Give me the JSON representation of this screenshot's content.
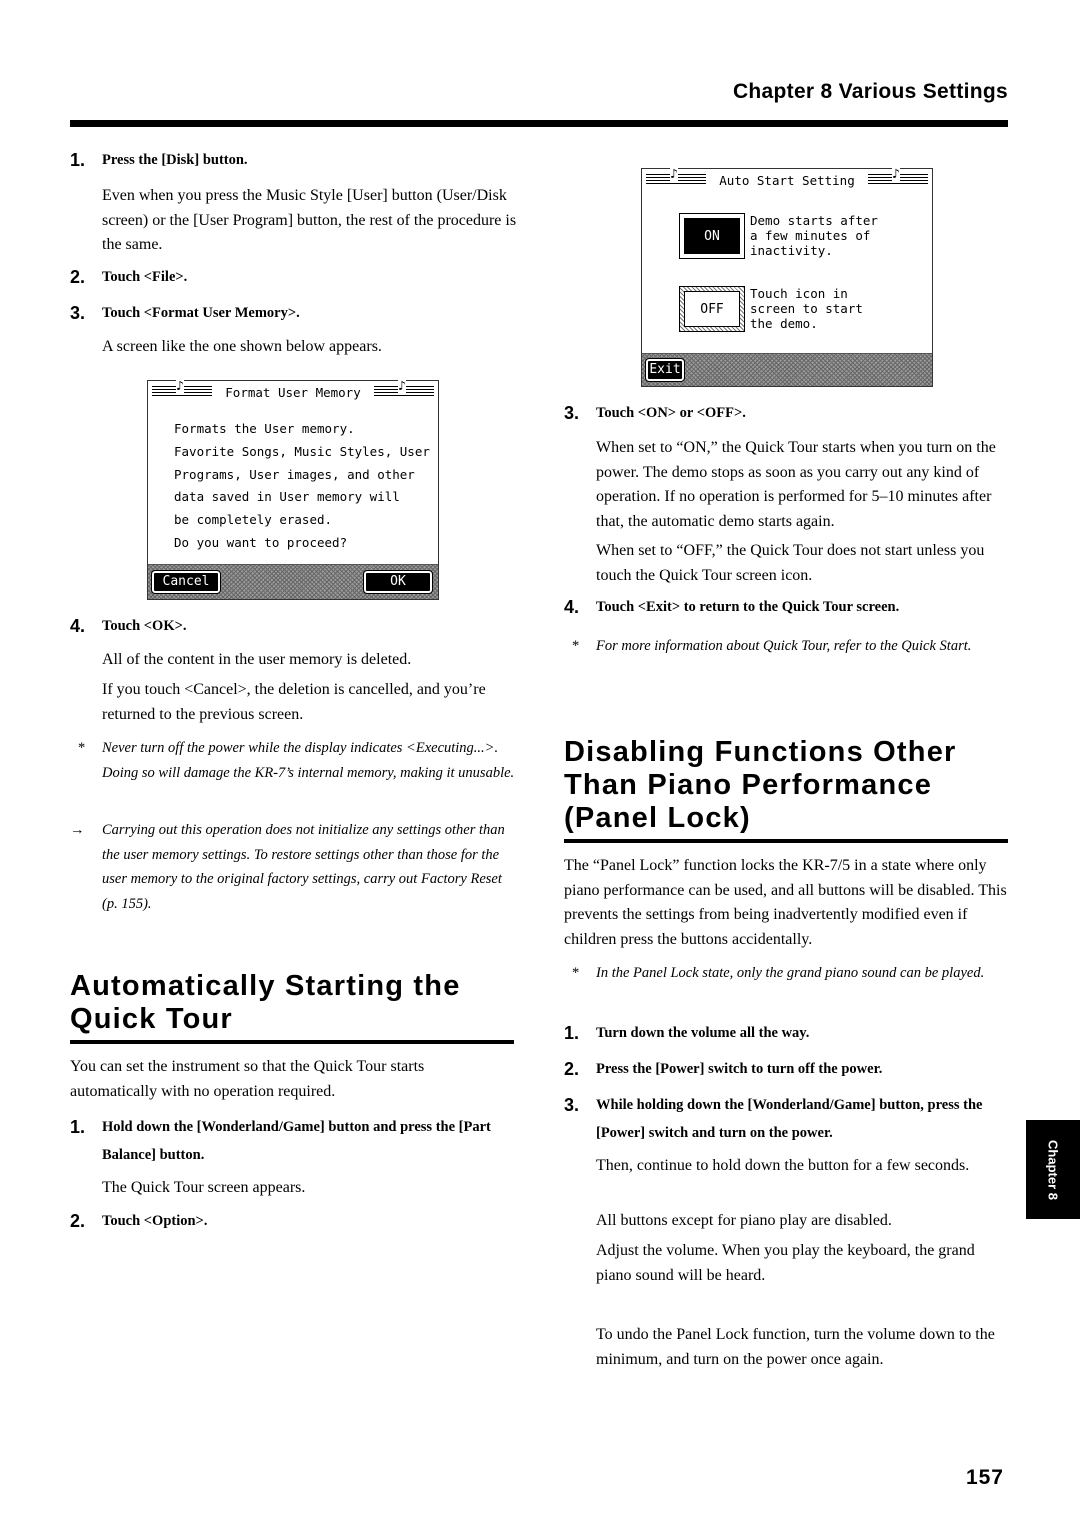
{
  "header": {
    "chapter": "Chapter 8  Various Settings"
  },
  "left": {
    "steps_a": [
      {
        "num": "1.",
        "text": "Press the [Disk] button."
      },
      {
        "num": "2.",
        "text": "Touch <File>."
      },
      {
        "num": "3.",
        "text": "Touch <Format User Memory>."
      },
      {
        "num": "4.",
        "text": "Touch <OK>."
      }
    ],
    "para_disk": "Even when you press the Music Style [User] button (User/Disk screen) or the [User Program] button, the rest of the procedure is the same.",
    "para_screen": "A screen like the one shown below appears.",
    "format_screen": {
      "title": "Format User Memory",
      "lines": [
        "Formats the User memory.",
        "Favorite Songs, Music Styles, User",
        "Programs, User images, and other",
        "data saved in User memory will",
        "be completely erased.",
        "Do you want to proceed?"
      ],
      "cancel_label": "Cancel",
      "ok_label": "OK"
    },
    "para_deleted": "All of the content in the user memory is deleted.",
    "para_cancel": "If you touch <Cancel>, the deletion is cancelled, and you’re returned to the previous screen.",
    "note_power": {
      "mark": "*",
      "text": "Never turn off the power while the display indicates <Executing...>. Doing so will damage the KR-7’s internal memory, making it unusable."
    },
    "note_factory": {
      "mark": "→",
      "text": "Carrying out this operation does not initialize any settings other than the user memory settings. To restore settings other than those for the user memory to the original factory settings, carry out Factory Reset (p. 155)."
    },
    "section_quick_tour": {
      "heading": "Automatically Starting the Quick Tour",
      "intro": "You can set the instrument so that the Quick Tour starts automatically with no operation required.",
      "steps": [
        {
          "num": "1.",
          "text": "Hold down the [Wonderland/Game] button and press the [Part Balance] button."
        },
        {
          "num": "2.",
          "text": "Touch <Option>."
        }
      ],
      "para_appears": "The Quick Tour screen appears."
    }
  },
  "right": {
    "auto_start_screen": {
      "title": "Auto Start Setting",
      "on_label": "ON",
      "on_desc": [
        "Demo starts after",
        "a few minutes of",
        "inactivity."
      ],
      "off_label": "OFF",
      "off_desc": [
        "Touch icon in",
        "screen to start",
        "the demo."
      ],
      "exit_label": "Exit",
      "selected": "ON"
    },
    "step3": {
      "num": "3.",
      "text": "Touch <ON> or <OFF>."
    },
    "para_on": "When set to “ON,” the Quick Tour starts when you turn on the power. The demo stops as soon as you carry out any kind of operation. If no operation is performed for 5–10 minutes after that, the automatic demo starts again.",
    "para_off": "When set to “OFF,” the Quick Tour does not start unless you touch the Quick Tour screen icon.",
    "step4": {
      "num": "4.",
      "text": "Touch <Exit> to return to the Quick Tour screen."
    },
    "note_quickstart": {
      "mark": "*",
      "text": "For more information about Quick Tour, refer to the Quick Start."
    },
    "section_panel_lock": {
      "heading": "Disabling Functions Other Than Piano Performance (Panel Lock)",
      "intro": "The “Panel Lock” function locks the KR-7/5 in a state where only piano performance can be used, and all buttons will be disabled. This prevents the settings from being inadvertently modified even if children press the buttons accidentally.",
      "note": {
        "mark": "*",
        "text": "In the Panel Lock state, only the grand piano sound can be played."
      },
      "steps": [
        {
          "num": "1.",
          "text": "Turn down the volume all the way."
        },
        {
          "num": "2.",
          "text": "Press the [Power] switch to turn off the power."
        },
        {
          "num": "3.",
          "text": "While holding down the [Wonderland/Game] button, press the [Power] switch and turn on the power."
        }
      ],
      "para_hold": "Then, continue to hold down the button for a few seconds.",
      "para_disabled": "All buttons except for piano play are disabled.",
      "para_adjust": "Adjust the volume. When you play the keyboard, the grand piano sound will be heard.",
      "para_undo": "To undo the Panel Lock function, turn the volume down to the minimum, and turn on the power once again."
    }
  },
  "side_tab": {
    "label": "Chapter 8"
  },
  "footer": {
    "page_number": "157"
  }
}
